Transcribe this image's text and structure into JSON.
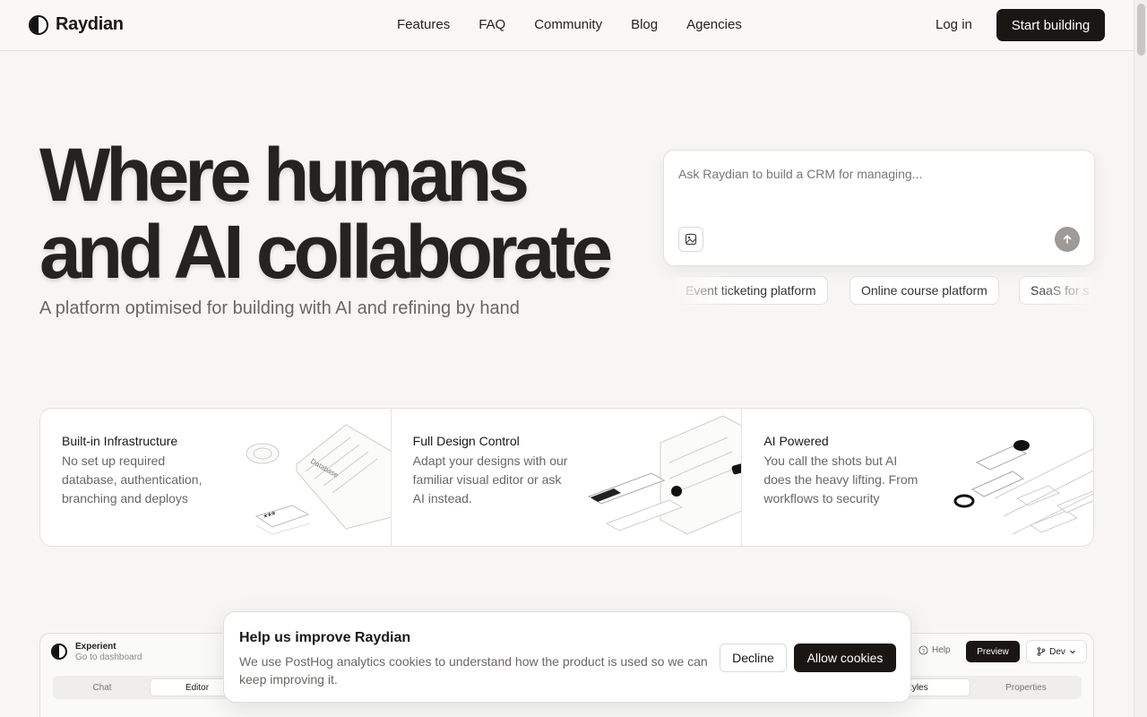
{
  "brand": {
    "name": "Raydian"
  },
  "nav": {
    "links": [
      "Features",
      "FAQ",
      "Community",
      "Blog",
      "Agencies"
    ],
    "login": "Log in",
    "cta": "Start building"
  },
  "hero": {
    "title_line1": "Where humans",
    "title_line2": "and AI collaborate",
    "subtitle": "A platform optimised for building with AI and refining by hand"
  },
  "prompt": {
    "placeholder": "Ask Raydian to build a CRM for managing...",
    "suggestions": [
      "Event ticketing platform",
      "Online course platform",
      "SaaS for s"
    ]
  },
  "features": [
    {
      "title": "Built-in Infrastructure",
      "description": "No set up required database, authentication, branching and deploys"
    },
    {
      "title": "Full Design Control",
      "description": "Adapt your designs with our familiar visual editor or ask AI instead."
    },
    {
      "title": "AI Powered",
      "description": "You call the shots but AI does the heavy lifting. From workflows to security"
    }
  ],
  "app_preview": {
    "project_name": "Experient",
    "project_sub": "Go to dashboard",
    "tabs": [
      "Chat",
      "Editor"
    ],
    "active_tab": "Editor",
    "help": "Help",
    "preview": "Preview",
    "branch": "Dev",
    "right_tabs": [
      "Styles",
      "Properties"
    ]
  },
  "cookie": {
    "title": "Help us improve Raydian",
    "text": "We use PostHog analytics cookies to understand how the product is used so we can keep improving it.",
    "decline": "Decline",
    "allow": "Allow cookies"
  },
  "colors": {
    "primary_dark": "#1a1614",
    "background": "#f7f6f4",
    "muted_text": "#6a6663"
  }
}
